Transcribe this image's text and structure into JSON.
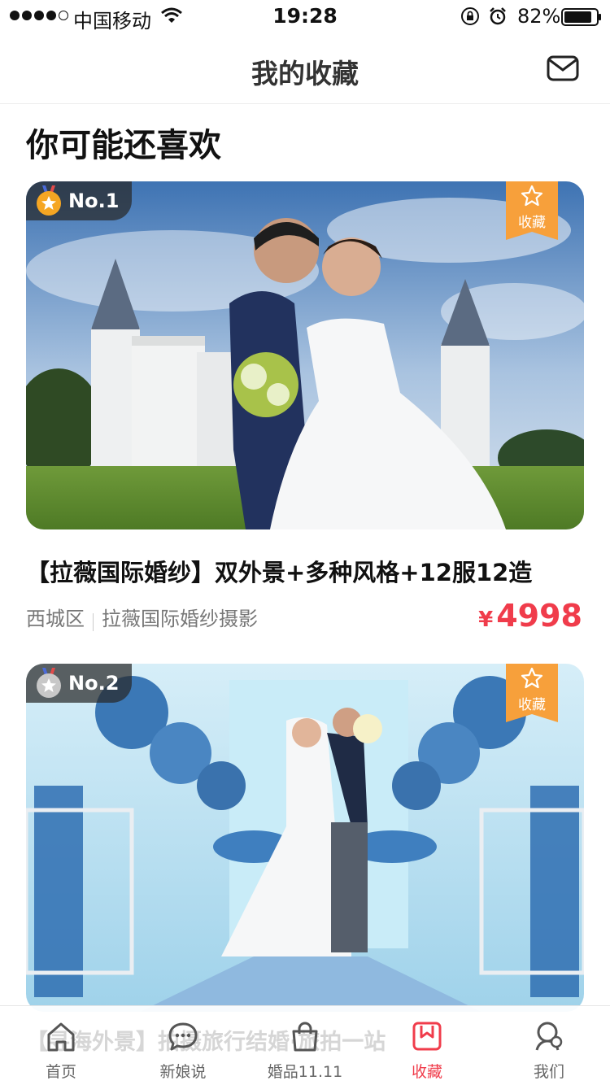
{
  "status_bar": {
    "carrier": "中国移动",
    "time": "19:28",
    "battery": "82%",
    "icons": [
      "signal-icon",
      "wifi-icon",
      "orientation-lock-icon",
      "alarm-icon",
      "battery-icon"
    ]
  },
  "nav": {
    "title": "我的收藏",
    "right_icon": "mail-icon"
  },
  "section_title": "你可能还喜欢",
  "cards": [
    {
      "rank": "No.1",
      "medal": "gold",
      "fav_label": "收藏",
      "title": "【拉薇国际婚纱】双外景+多种风格+12服12造",
      "district": "西城区",
      "studio": "拉薇国际婚纱摄影",
      "currency": "¥",
      "price": "4998"
    },
    {
      "rank": "No.2",
      "medal": "silver",
      "fav_label": "收藏"
    }
  ],
  "behind_text": "【寻海外景】拍摄旅行结婚·旅拍一站",
  "tabs": [
    {
      "label": "首页",
      "icon": "home-icon",
      "active": false
    },
    {
      "label": "新娘说",
      "icon": "chat-bubble-icon",
      "active": false
    },
    {
      "label": "婚品11.11",
      "icon": "shopping-bag-icon",
      "active": false
    },
    {
      "label": "收藏",
      "icon": "bookmark-icon",
      "active": true
    },
    {
      "label": "我们",
      "icon": "profile-icon",
      "active": false
    }
  ],
  "colors": {
    "accent": "#f03c4b",
    "fav_tag": "#f7a03b",
    "gold_medal": "#f5a623",
    "silver_medal": "#c8c8c8"
  }
}
